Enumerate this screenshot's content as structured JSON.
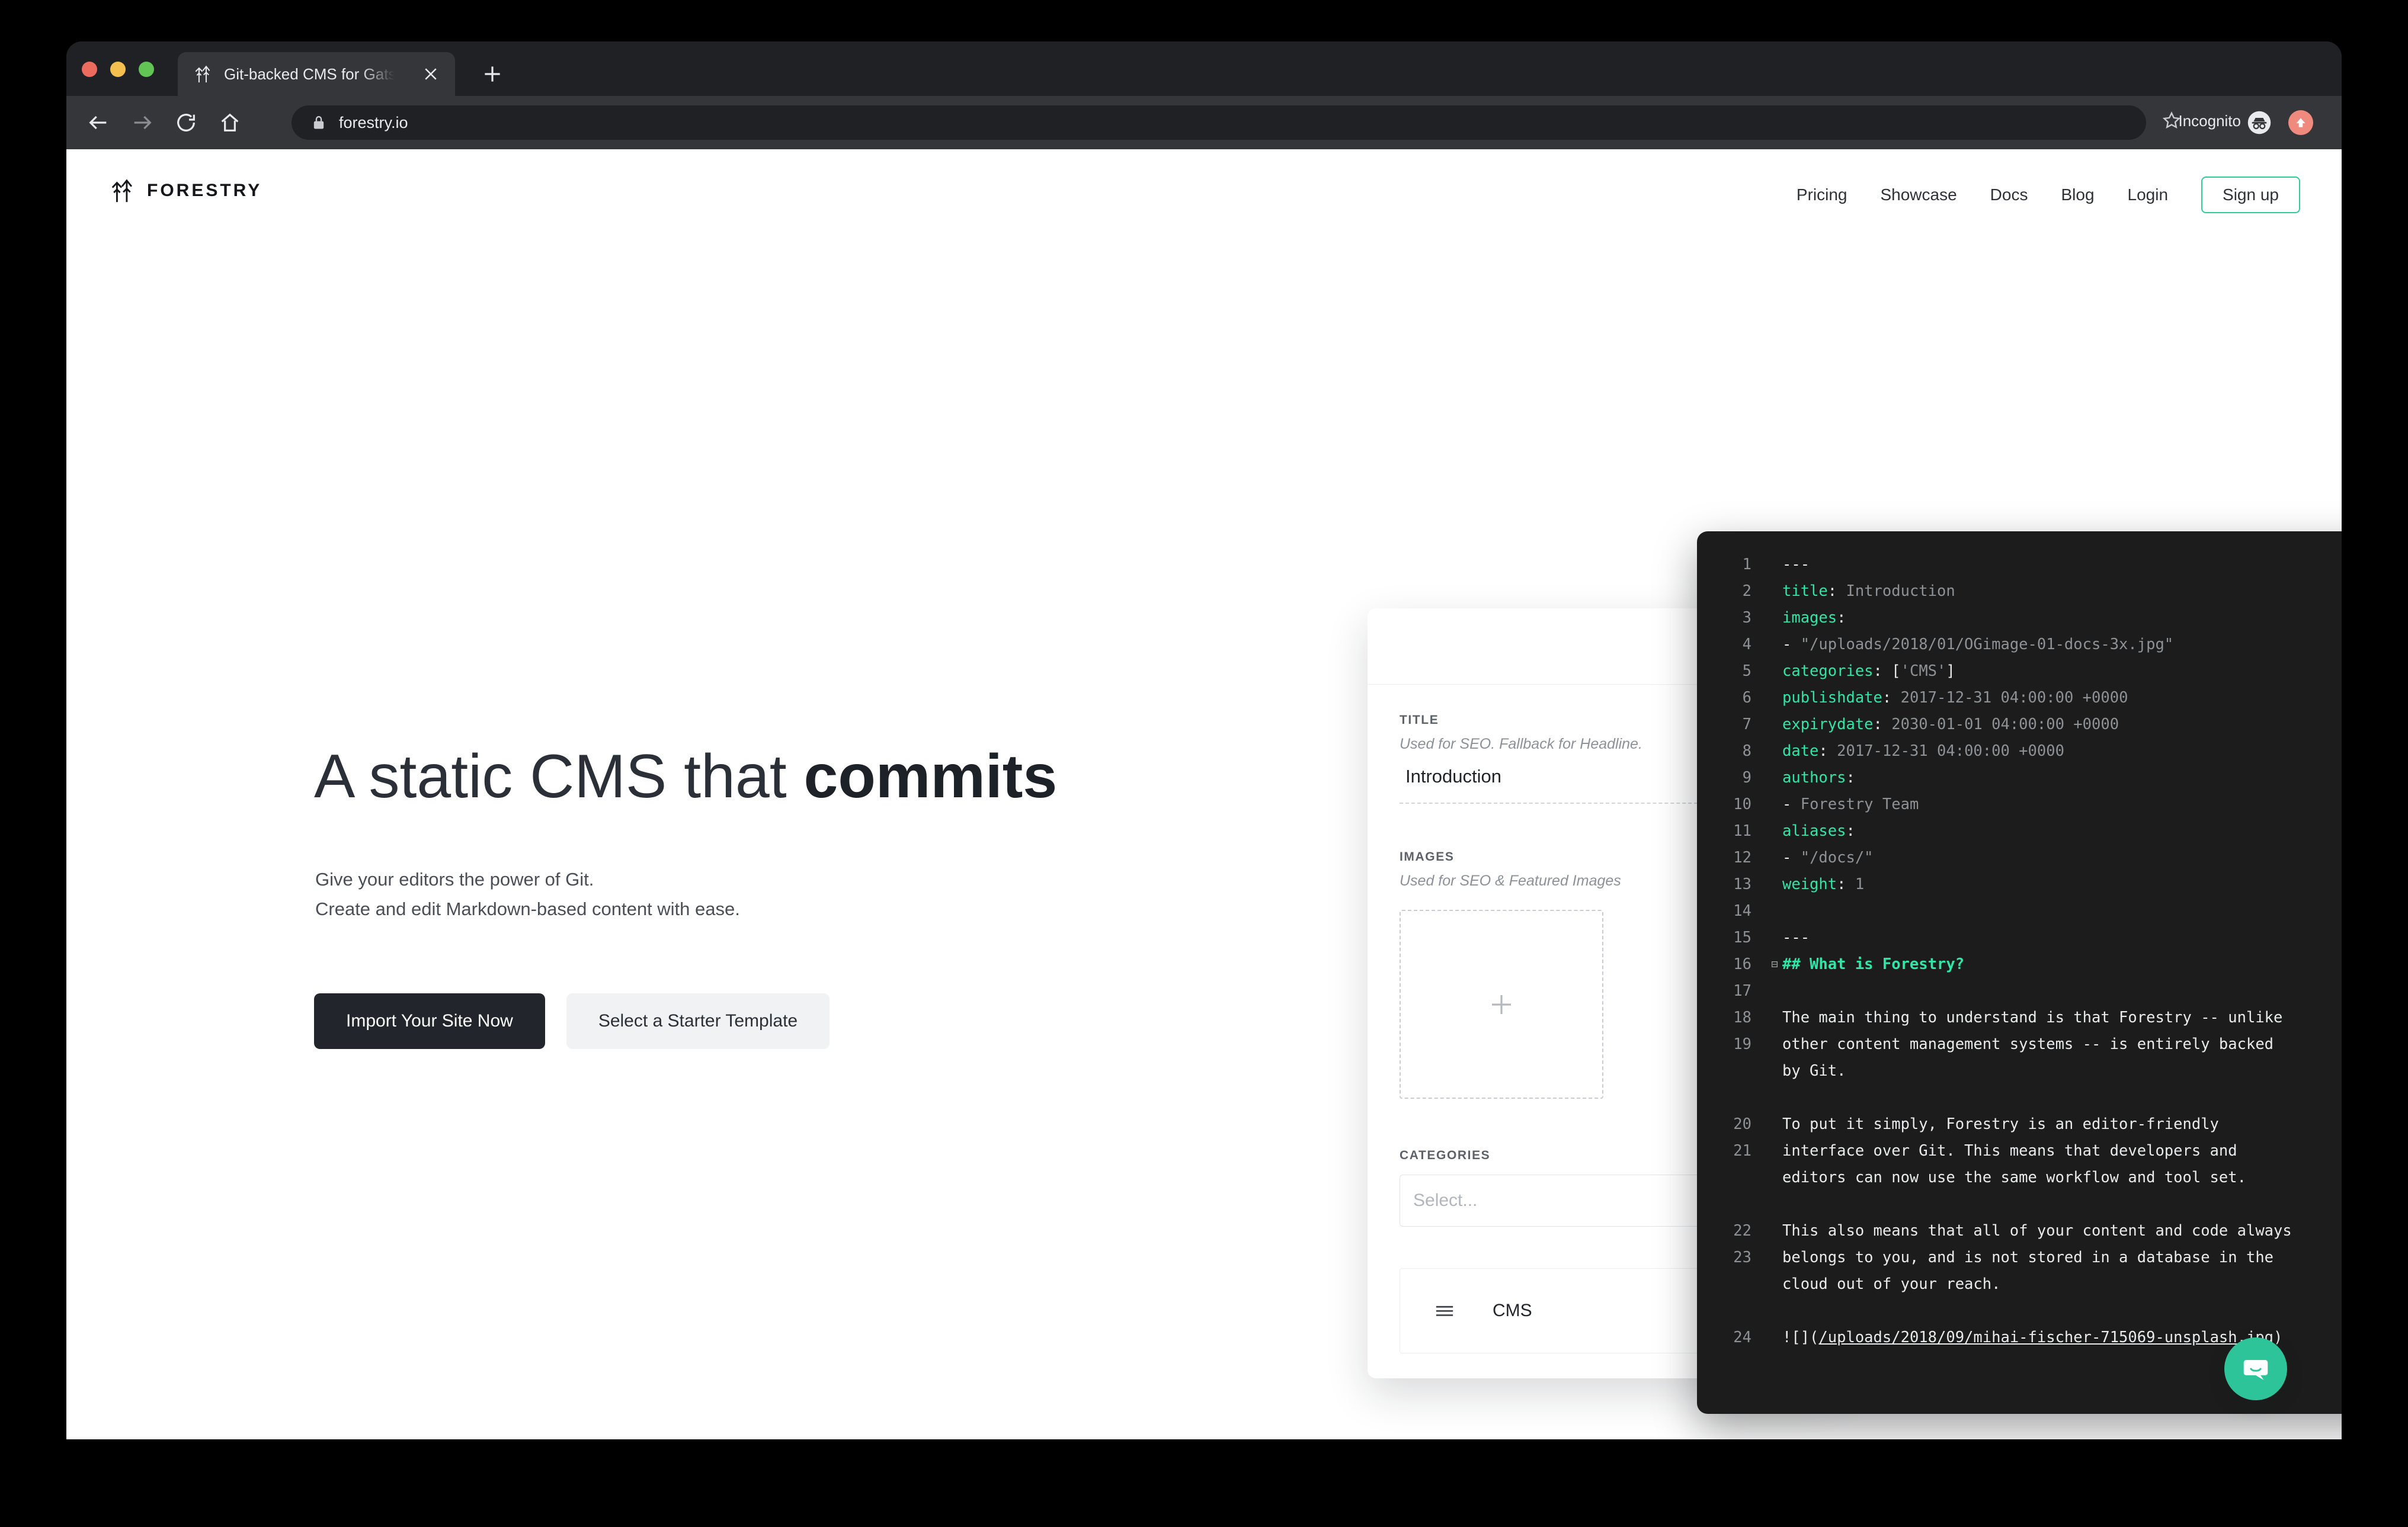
{
  "browser": {
    "tab_title": "Git-backed CMS for Gatsby, Gr",
    "url": "forestry.io",
    "incognito_label": "Incognito",
    "icons": {
      "favicon": "forestry-tree-icon",
      "close_tab": "close-icon",
      "new_tab": "plus-icon",
      "back": "back-arrow-icon",
      "forward": "forward-arrow-icon",
      "reload": "reload-icon",
      "home": "home-icon",
      "lock": "lock-icon",
      "bookmark": "star-icon",
      "incognito": "incognito-spy-icon",
      "update": "update-arrow-icon"
    }
  },
  "site": {
    "logo_text": "FORESTRY",
    "nav": [
      {
        "label": "Pricing"
      },
      {
        "label": "Showcase"
      },
      {
        "label": "Docs"
      },
      {
        "label": "Blog"
      },
      {
        "label": "Login"
      }
    ],
    "signup_label": "Sign up",
    "accent_color": "#2ecc9b"
  },
  "hero": {
    "headline_light": "A static CMS that ",
    "headline_bold": "commits",
    "sub_line1": "Give your editors the power of Git.",
    "sub_line2": "Create and edit Markdown-based content with ease.",
    "cta_primary": "Import Your Site Now",
    "cta_secondary": "Select a Starter Template"
  },
  "editor": {
    "title_label": "TITLE",
    "title_hint": "Used for SEO. Fallback for Headline.",
    "title_value": "Introduction",
    "images_label": "IMAGES",
    "images_hint": "Used for SEO & Featured Images",
    "dropzone_icon": "plus-icon",
    "categories_label": "CATEGORIES",
    "categories_placeholder": "Select...",
    "category_item": "CMS",
    "drag_icon": "drag-handle-icon"
  },
  "code": {
    "lines": [
      {
        "n": "1",
        "fold": "",
        "segs": [
          {
            "t": "---",
            "c": "ctext"
          }
        ]
      },
      {
        "n": "2",
        "fold": "",
        "segs": [
          {
            "t": "title",
            "c": "k"
          },
          {
            "t": ": ",
            "c": "ctext"
          },
          {
            "t": "Introduction",
            "c": "v"
          }
        ]
      },
      {
        "n": "3",
        "fold": "",
        "segs": [
          {
            "t": "images",
            "c": "k"
          },
          {
            "t": ":",
            "c": "ctext"
          }
        ]
      },
      {
        "n": "4",
        "fold": "",
        "segs": [
          {
            "t": "- ",
            "c": "ctext"
          },
          {
            "t": "\"/uploads/2018/01/OGimage-01-docs-3x.jpg\"",
            "c": "v"
          }
        ]
      },
      {
        "n": "5",
        "fold": "",
        "segs": [
          {
            "t": "categories",
            "c": "k"
          },
          {
            "t": ": ",
            "c": "ctext"
          },
          {
            "t": "[",
            "c": "ctext"
          },
          {
            "t": "'CMS'",
            "c": "v"
          },
          {
            "t": "]",
            "c": "ctext"
          }
        ]
      },
      {
        "n": "6",
        "fold": "",
        "segs": [
          {
            "t": "publishdate",
            "c": "k"
          },
          {
            "t": ": ",
            "c": "ctext"
          },
          {
            "t": "2017-12-31 04:00:00 +0000",
            "c": "v"
          }
        ]
      },
      {
        "n": "7",
        "fold": "",
        "segs": [
          {
            "t": "expirydate",
            "c": "k"
          },
          {
            "t": ": ",
            "c": "ctext"
          },
          {
            "t": "2030-01-01 04:00:00 +0000",
            "c": "v"
          }
        ]
      },
      {
        "n": "8",
        "fold": "",
        "segs": [
          {
            "t": "date",
            "c": "k"
          },
          {
            "t": ": ",
            "c": "ctext"
          },
          {
            "t": "2017-12-31 04:00:00 +0000",
            "c": "v"
          }
        ]
      },
      {
        "n": "9",
        "fold": "",
        "segs": [
          {
            "t": "authors",
            "c": "k"
          },
          {
            "t": ":",
            "c": "ctext"
          }
        ]
      },
      {
        "n": "10",
        "fold": "",
        "segs": [
          {
            "t": "- ",
            "c": "ctext"
          },
          {
            "t": "Forestry Team",
            "c": "v"
          }
        ]
      },
      {
        "n": "11",
        "fold": "",
        "segs": [
          {
            "t": "aliases",
            "c": "k"
          },
          {
            "t": ":",
            "c": "ctext"
          }
        ]
      },
      {
        "n": "12",
        "fold": "",
        "segs": [
          {
            "t": "- ",
            "c": "ctext"
          },
          {
            "t": "\"/docs/\"",
            "c": "v"
          }
        ]
      },
      {
        "n": "13",
        "fold": "",
        "segs": [
          {
            "t": "weight",
            "c": "k"
          },
          {
            "t": ": ",
            "c": "ctext"
          },
          {
            "t": "1",
            "c": "v"
          }
        ]
      },
      {
        "n": "14",
        "fold": "",
        "segs": []
      },
      {
        "n": "15",
        "fold": "",
        "segs": [
          {
            "t": "---",
            "c": "ctext"
          }
        ]
      },
      {
        "n": "16",
        "fold": "-",
        "segs": [
          {
            "t": "## What is Forestry?",
            "c": "h"
          }
        ]
      },
      {
        "n": "17",
        "fold": "",
        "segs": []
      },
      {
        "n": "18",
        "fold": "",
        "segs": [
          {
            "t": "The main thing to understand is that Forestry -- unlike",
            "c": "ctext"
          }
        ]
      },
      {
        "n": "19",
        "fold": "",
        "segs": [
          {
            "t": "other content management systems -- is entirely backed\nby Git.",
            "c": "ctext"
          }
        ]
      },
      {
        "n": "",
        "fold": "",
        "segs": []
      },
      {
        "n": "20",
        "fold": "",
        "segs": [
          {
            "t": "To put it simply, Forestry is an editor-friendly",
            "c": "ctext"
          }
        ]
      },
      {
        "n": "21",
        "fold": "",
        "segs": [
          {
            "t": "interface over Git. This means that developers and\neditors can now use the same workflow and tool set.",
            "c": "ctext"
          }
        ]
      },
      {
        "n": "",
        "fold": "",
        "segs": []
      },
      {
        "n": "22",
        "fold": "",
        "segs": [
          {
            "t": "This also means that all of your content and code always",
            "c": "ctext"
          }
        ]
      },
      {
        "n": "23",
        "fold": "",
        "segs": [
          {
            "t": "belongs to you, and is not stored in a database in the\ncloud out of your reach.",
            "c": "ctext"
          }
        ]
      },
      {
        "n": "",
        "fold": "",
        "segs": []
      },
      {
        "n": "24",
        "fold": "",
        "segs": [
          {
            "t": "![](",
            "c": "ctext"
          },
          {
            "t": "/uploads/2018/09/mihai-fischer-715069-unsplash.jpg",
            "c": "ctext u"
          },
          {
            "t": ")",
            "c": "ctext"
          }
        ]
      }
    ]
  },
  "widgets": {
    "chat_icon": "chat-bubble-icon",
    "chat_color": "#2ec49a"
  }
}
